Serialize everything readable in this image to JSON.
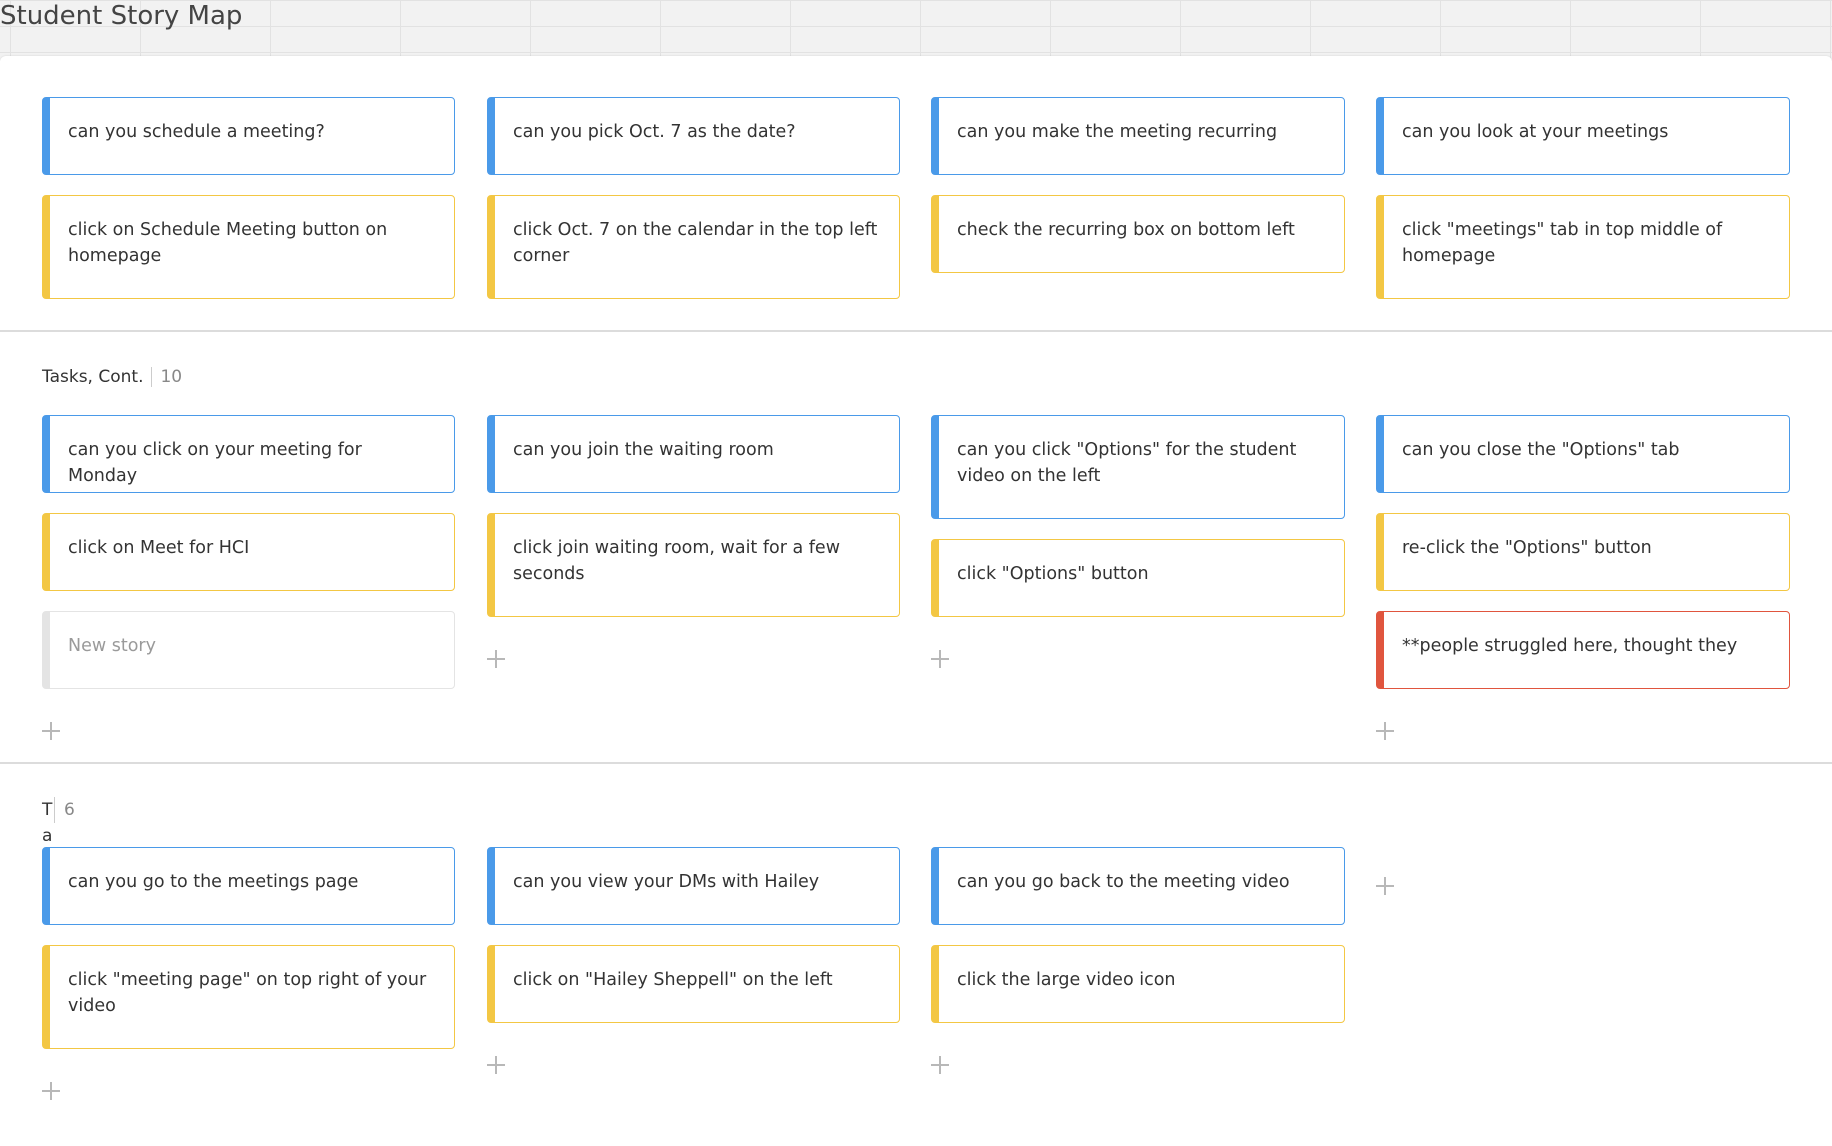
{
  "board": {
    "title": "Student Story Map"
  },
  "colors": {
    "story_blue": "#4a9ae9",
    "story_yellow": "#f3c744",
    "story_red": "#e0553e",
    "story_placeholder": "#e4e4e4",
    "divider": "#dcdcdc"
  },
  "releases": [
    {
      "name": "",
      "count": "",
      "columns": [
        [
          "can you schedule a meeting?",
          "click on Schedule Meeting button on homepage"
        ],
        [
          "can you pick Oct. 7 as the date?",
          "click Oct. 7 on the calendar in the top left corner"
        ],
        [
          "can you make the meeting recurring",
          "check the recurring box on bottom left"
        ],
        [
          "can you look at your meetings",
          "click \"meetings\" tab in top middle of homepage"
        ]
      ]
    },
    {
      "name": "Tasks, Cont.",
      "count": "10",
      "columns": [
        [
          "can you click on your meeting for Monday",
          "click on Meet for HCI",
          "New story"
        ],
        [
          "can you join the waiting room",
          "click join waiting room, wait for a few seconds"
        ],
        [
          "can you click \"Options\" for the student video on the left",
          "click \"Options\" button"
        ],
        [
          "can you close the \"Options\" tab",
          "re-click the \"Options\" button",
          "**people struggled here, thought they"
        ]
      ]
    },
    {
      "name": "Ta",
      "count": "6",
      "columns": [
        [
          "can you go to the meetings page",
          "click \"meeting page\" on top right of your video"
        ],
        [
          "can you view your DMs with Hailey",
          "click on \"Hailey Sheppell\" on the left"
        ],
        [
          "can you go back to the meeting video",
          "click the large video icon"
        ]
      ]
    }
  ],
  "icons": {
    "add": "plus-icon"
  }
}
